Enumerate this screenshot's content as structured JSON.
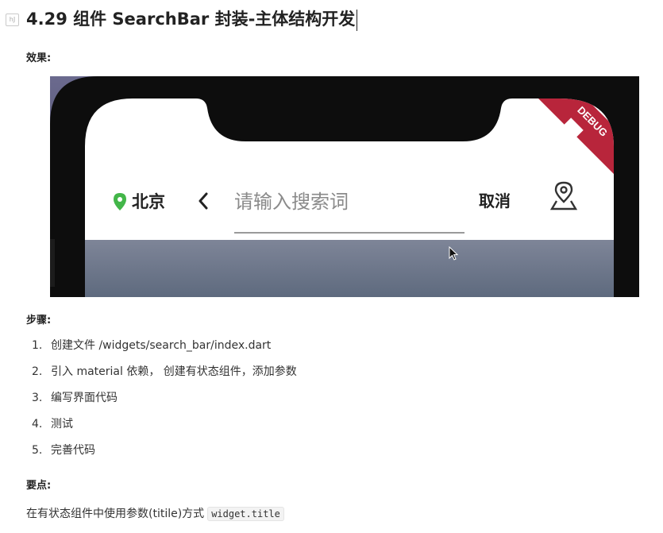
{
  "doc": {
    "title": "4.29 组件 SearchBar 封装-主体结构开发",
    "effect_heading": "效果:",
    "steps_heading": "步骤:",
    "steps": [
      {
        "num": "1.",
        "text": "创建文件 /widgets/search_bar/index.dart"
      },
      {
        "num": "2.",
        "text": "引入 material 依赖， 创建有状态组件，添加参数"
      },
      {
        "num": "3.",
        "text": "编写界面代码"
      },
      {
        "num": "4.",
        "text": "测试"
      },
      {
        "num": "5.",
        "text": "完善代码"
      }
    ],
    "key_heading": "要点:",
    "key_text": "在有状态组件中使用参数(titile)方式",
    "key_code": "widget.title"
  },
  "preview": {
    "city": "北京",
    "search_placeholder": "请输入搜索词",
    "cancel_label": "取消",
    "debug_banner": "DEBUG",
    "accent_green": "#43b649",
    "banner_red": "#b8253b",
    "icons": [
      "location-pin-icon",
      "back-chevron-icon",
      "map-location-icon"
    ]
  }
}
